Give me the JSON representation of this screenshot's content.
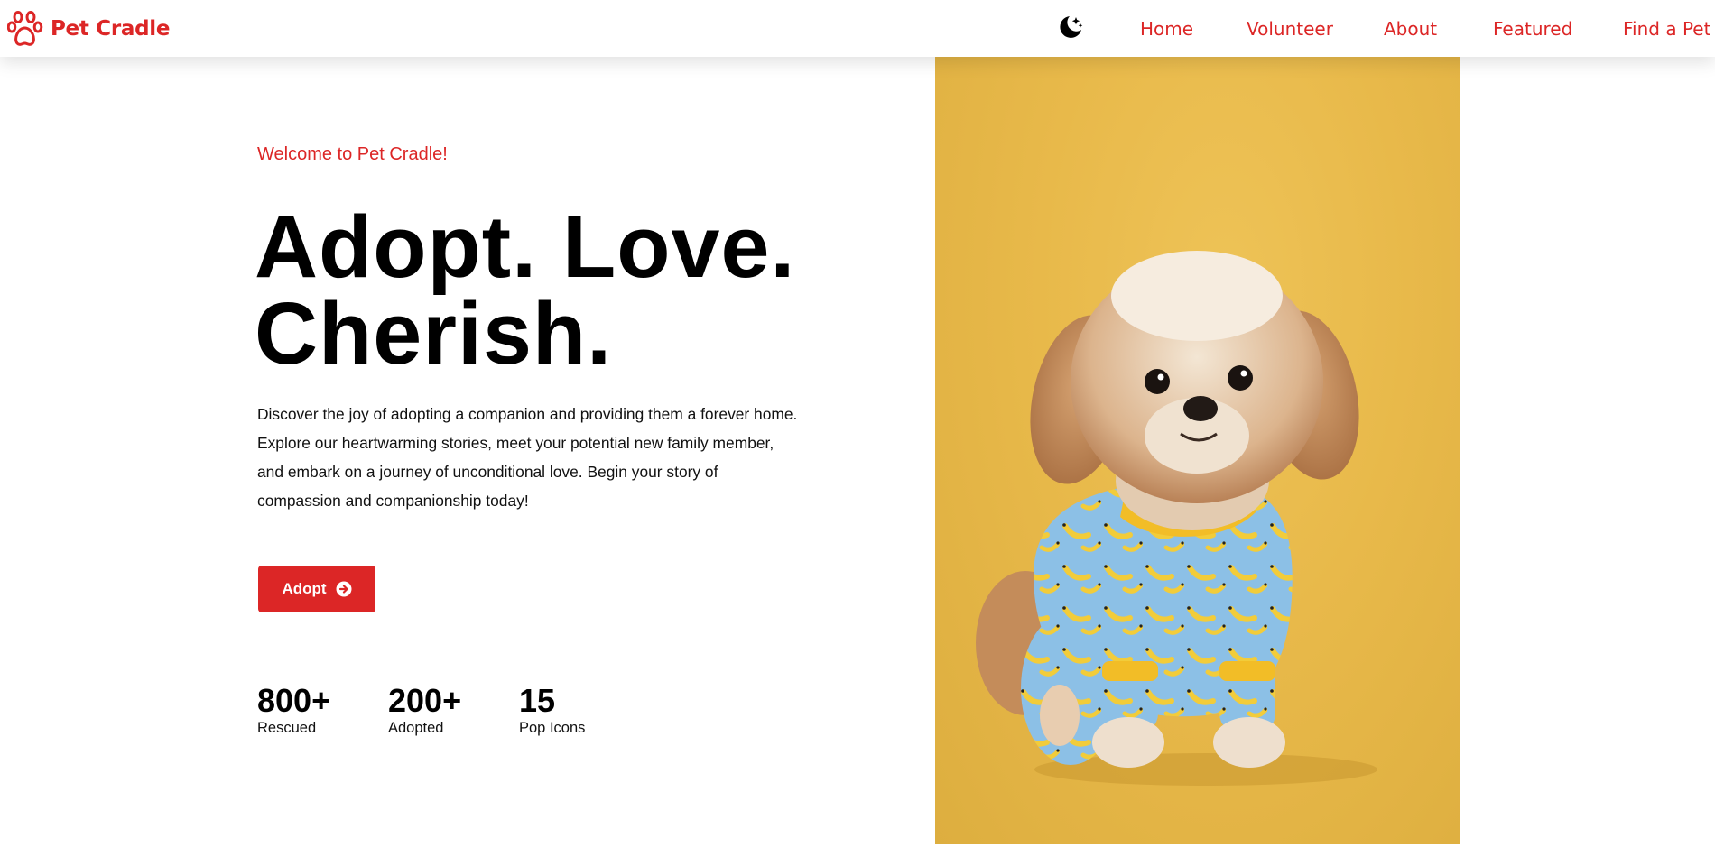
{
  "brand": {
    "name": "Pet Cradle",
    "icon": "paw-icon",
    "color": "#dc2626"
  },
  "nav": {
    "theme_toggle_icon": "moon-stars-icon",
    "links": [
      "Home",
      "Volunteer",
      "About",
      "Featured",
      "Find a Pet"
    ]
  },
  "hero": {
    "welcome": "Welcome to Pet Cradle!",
    "headline_line1": "Adopt. Love.",
    "headline_line2": "Cherish.",
    "description": "Discover the joy of adopting a companion and providing them a forever home. Explore our heartwarming stories, meet your potential new family member, and embark on a journey of unconditional love. Begin your story of compassion and companionship today!",
    "button_label": "Adopt",
    "button_icon": "arrow-right-circle-icon"
  },
  "stats": [
    {
      "value": "800+",
      "label": "Rescued"
    },
    {
      "value": "200+",
      "label": "Adopted"
    },
    {
      "value": "15",
      "label": "Pop Icons"
    }
  ],
  "image": {
    "subject": "dog-photo",
    "background_color": "#e8b94a"
  }
}
